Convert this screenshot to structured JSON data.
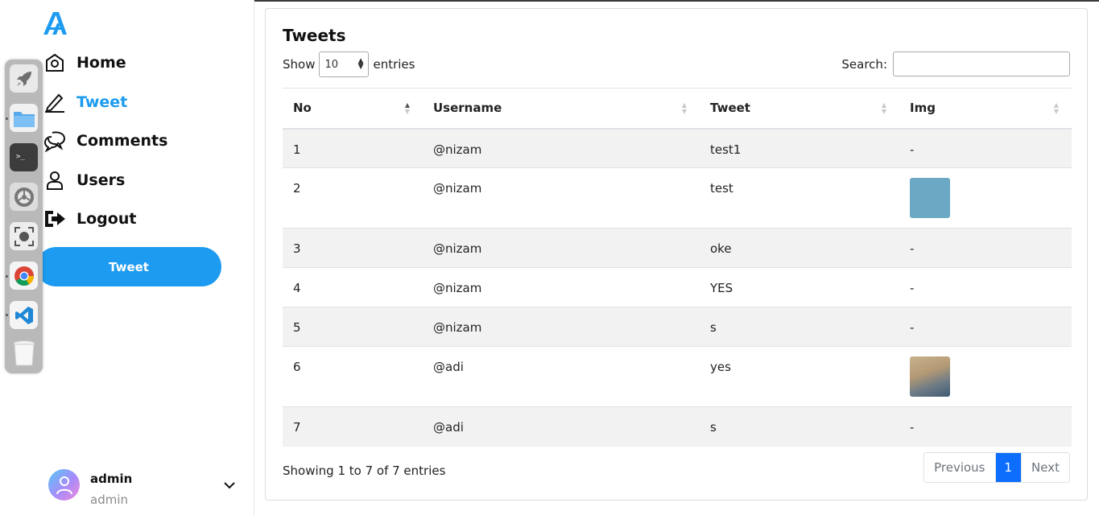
{
  "sidebar": {
    "nav": [
      {
        "label": "Home",
        "icon": "home-icon"
      },
      {
        "label": "Tweet",
        "icon": "pencil-icon",
        "active": true
      },
      {
        "label": "Comments",
        "icon": "chat-bubbles-icon"
      },
      {
        "label": "Users",
        "icon": "user-icon"
      },
      {
        "label": "Logout",
        "icon": "logout-icon"
      }
    ],
    "tweet_button": "Tweet",
    "profile": {
      "name": "admin",
      "role": "admin"
    }
  },
  "dock": [
    "rocket-launcher-icon",
    "files-icon",
    "terminal-icon",
    "settings-icon",
    "screenshot-icon",
    "chrome-icon",
    "vscode-icon",
    "trash-icon"
  ],
  "main": {
    "title": "Tweets",
    "length": {
      "show": "Show",
      "value": "10",
      "entries": "entries"
    },
    "search": {
      "label": "Search:",
      "value": ""
    },
    "columns": [
      "No",
      "Username",
      "Tweet",
      "Img"
    ],
    "rows": [
      {
        "no": "1",
        "username": "@nizam",
        "tweet": "test1",
        "img": "-"
      },
      {
        "no": "2",
        "username": "@nizam",
        "tweet": "test",
        "img": "image"
      },
      {
        "no": "3",
        "username": "@nizam",
        "tweet": "oke",
        "img": "-"
      },
      {
        "no": "4",
        "username": "@nizam",
        "tweet": "YES",
        "img": "-"
      },
      {
        "no": "5",
        "username": "@nizam",
        "tweet": "s",
        "img": "-"
      },
      {
        "no": "6",
        "username": "@adi",
        "tweet": "yes",
        "img": "photo"
      },
      {
        "no": "7",
        "username": "@adi",
        "tweet": "s",
        "img": "-"
      }
    ],
    "info": "Showing 1 to 7 of 7 entries",
    "pagination": {
      "previous": "Previous",
      "current": "1",
      "next": "Next"
    }
  },
  "colors": {
    "accent": "#1d9bf0",
    "page_active": "#0d6efd"
  }
}
